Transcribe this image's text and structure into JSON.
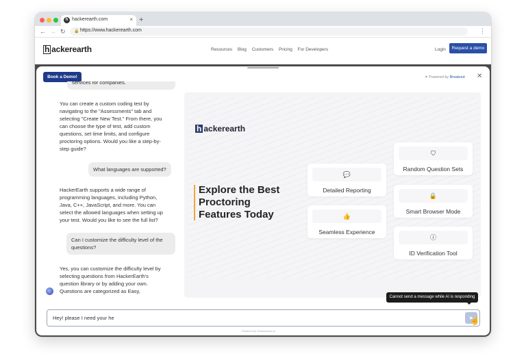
{
  "browser": {
    "tab_title": "hackerearth.com",
    "tab_favicon": "h",
    "url": "https://www.hackerearth.com",
    "traffic_colors": [
      "#ff5f57",
      "#febc2e",
      "#28c840"
    ]
  },
  "site": {
    "logo_h": "h",
    "logo_rest": "ackerearth",
    "nav": [
      "Resources",
      "Blog",
      "Customers",
      "Pricing",
      "For Developers"
    ],
    "login": "Login",
    "request_demo": "Request a demo"
  },
  "modal": {
    "book_demo": "Book a Demo!",
    "powered_by": "Powered by",
    "powered_brand": "Breakout",
    "close": "✕",
    "footer_note": "Powered by Getbreakout.ai"
  },
  "chat": {
    "messages": [
      {
        "role": "user",
        "text": "services for companies."
      },
      {
        "role": "bot",
        "text": "You can create a custom coding test by navigating to the \"Assessments\" tab and selecting \"Create New Test.\" From there, you can choose the type of test, add custom questions, set time limits, and configure proctoring options. Would you like a step-by-step guide?"
      },
      {
        "role": "user",
        "text": "What languages are supported?"
      },
      {
        "role": "bot",
        "text": "HackerEarth supports a wide range of programming languages, including Python, Java, C++, JavaScript, and more. You can select the allowed languages when setting up your test. Would you like to see the full list?"
      },
      {
        "role": "user",
        "text": "Can I customize the difficulty level of the questions?"
      },
      {
        "role": "bot",
        "text": "Yes, you can customize the difficulty level by selecting questions from HackerEarth's question library or by adding your own. Questions are categorized as Easy,"
      }
    ],
    "input_value": "Hey! please I need your he",
    "tooltip": "Cannot send a message while AI is responding"
  },
  "preview": {
    "logo_h": "h",
    "logo_rest": "ackerearth",
    "headline": "Explore the Best Proctoring Features Today",
    "cards": [
      {
        "label": "Detailed Reporting",
        "icon": "chat-icon",
        "glyph": "💬"
      },
      {
        "label": "Random Question Sets",
        "icon": "shield-icon",
        "glyph": "⛉"
      },
      {
        "label": "Seamless Experience",
        "icon": "thumbs-up-icon",
        "glyph": "👍"
      },
      {
        "label": "Smart Browser Mode",
        "icon": "lock-icon",
        "glyph": "🔒"
      },
      {
        "label": "ID Verification Tool",
        "icon": "info-icon",
        "glyph": "ⓘ"
      }
    ]
  }
}
